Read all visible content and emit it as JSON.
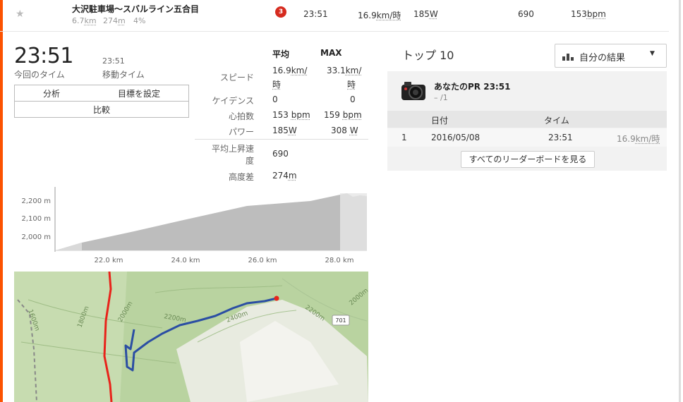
{
  "segment": {
    "title": "大沢駐車場～スバルライン五合目",
    "distance": "6.7",
    "distance_unit": "km",
    "elevation": "274",
    "elevation_unit": "m",
    "grade": "4%",
    "rank": "3",
    "time": "23:51",
    "speed": "16.9",
    "speed_unit": "km/時",
    "power": "185",
    "power_unit": "W",
    "vam": "690",
    "heartrate": "153",
    "hr_unit": "bpm"
  },
  "effort": {
    "elapsed_time": "23:51",
    "elapsed_label": "今回のタイム",
    "moving_time": "23:51",
    "moving_label": "移動タイム",
    "buttons": {
      "analysis": "分析",
      "set_goal": "目標を設定",
      "compare": "比較"
    }
  },
  "stats": {
    "col_avg": "平均",
    "col_max": "MAX",
    "rows": [
      {
        "label": "スピード",
        "avg": "16.9",
        "avg_unit": "km/時",
        "max": "33.1",
        "max_unit": "km/時"
      },
      {
        "label": "ケイデンス",
        "avg": "0",
        "max": "0"
      },
      {
        "label": "心拍数",
        "avg": "153",
        "avg_unit": "bpm",
        "max": "159",
        "max_unit": "bpm"
      },
      {
        "label": "パワー",
        "avg": "185",
        "avg_unit": "W",
        "max": "308",
        "max_unit": "W"
      }
    ],
    "vam_label_1": "平均上昇速",
    "vam_label_2": "度",
    "vam_value": "690",
    "elev_label": "高度差",
    "elev_value": "274",
    "elev_unit": "m"
  },
  "elevation_chart": {
    "y_ticks": [
      "2,200 m",
      "2,100 m",
      "2,000 m"
    ],
    "x_ticks": [
      "22.0 km",
      "24.0 km",
      "26.0 km",
      "28.0 km"
    ]
  },
  "map": {
    "labels": [
      "1600m",
      "1800m",
      "2000m",
      "2200m",
      "2400m",
      "2200m",
      "2000m"
    ],
    "road_badge": "701"
  },
  "leaderboard": {
    "title": "トップ 10",
    "dropdown_label": "自分の結果",
    "pr_label": "あなたのPR",
    "pr_time": "23:51",
    "pr_rank": "– /1",
    "columns": {
      "date": "日付",
      "time": "タイム"
    },
    "rows": [
      {
        "rank": "1",
        "date": "2016/05/08",
        "time": "23:51",
        "speed": "16.9",
        "speed_unit": "km/時"
      }
    ],
    "see_all": "すべてのリーダーボードを見る"
  },
  "colors": {
    "accent": "#fc5200",
    "rank_badge": "#d62b1f",
    "route": "#2b4ea3",
    "road": "#e8231a"
  }
}
